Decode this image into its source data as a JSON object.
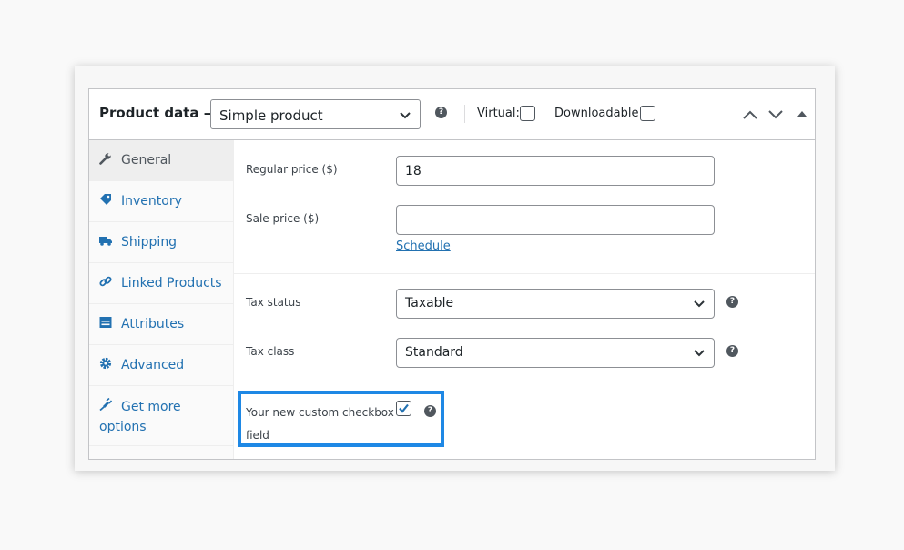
{
  "header": {
    "title": "Product data —",
    "product_type": {
      "selected": "Simple product"
    },
    "virtual_label": "Virtual:",
    "downloadable_label": "Downloadable:"
  },
  "tabs": [
    {
      "label": "General",
      "icon": "wrench-icon",
      "active": true
    },
    {
      "label": "Inventory",
      "icon": "tag-icon"
    },
    {
      "label": "Shipping",
      "icon": "truck-icon"
    },
    {
      "label": "Linked Products",
      "icon": "link-icon"
    },
    {
      "label": "Attributes",
      "icon": "list-icon"
    },
    {
      "label": "Advanced",
      "icon": "gear-icon"
    },
    {
      "label": "Get more options",
      "icon": "plugin-icon"
    }
  ],
  "general": {
    "regular_price": {
      "label": "Regular price ($)",
      "value": "18"
    },
    "sale_price": {
      "label": "Sale price ($)",
      "value": ""
    },
    "schedule_link": "Schedule",
    "tax_status": {
      "label": "Tax status",
      "selected": "Taxable"
    },
    "tax_class": {
      "label": "Tax class",
      "selected": "Standard"
    },
    "custom_checkbox": {
      "label": "Your new custom checkbox field",
      "checked": true
    }
  },
  "colors": {
    "link": "#2271b1",
    "highlight": "#1e88e5",
    "border": "#c3c4c7",
    "icon": "#50575e"
  }
}
